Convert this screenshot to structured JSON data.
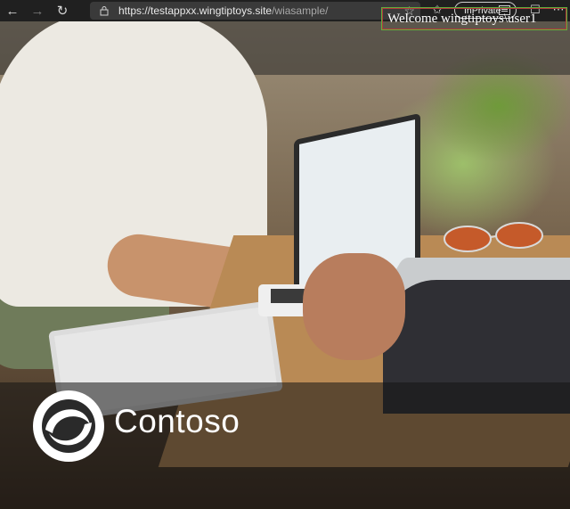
{
  "browser": {
    "url_host": "https://testappxx.wingtiptoys.site",
    "url_path": "/wiasample/",
    "inprivate_label": "InPrivate",
    "icons": [
      "back-arrow-icon",
      "forward-arrow-icon",
      "refresh-icon",
      "lock-icon",
      "star-icon",
      "favorites-icon",
      "inprivate-icon",
      "feedback-icon",
      "more-icon"
    ]
  },
  "page": {
    "welcome_text": "Welcome wingtiptoys\\user1",
    "brand_name": "Contoso"
  },
  "colors": {
    "chrome_bg": "#202020",
    "welcome_border_red": "#b23a3a",
    "welcome_border_green": "#5fae3c"
  }
}
